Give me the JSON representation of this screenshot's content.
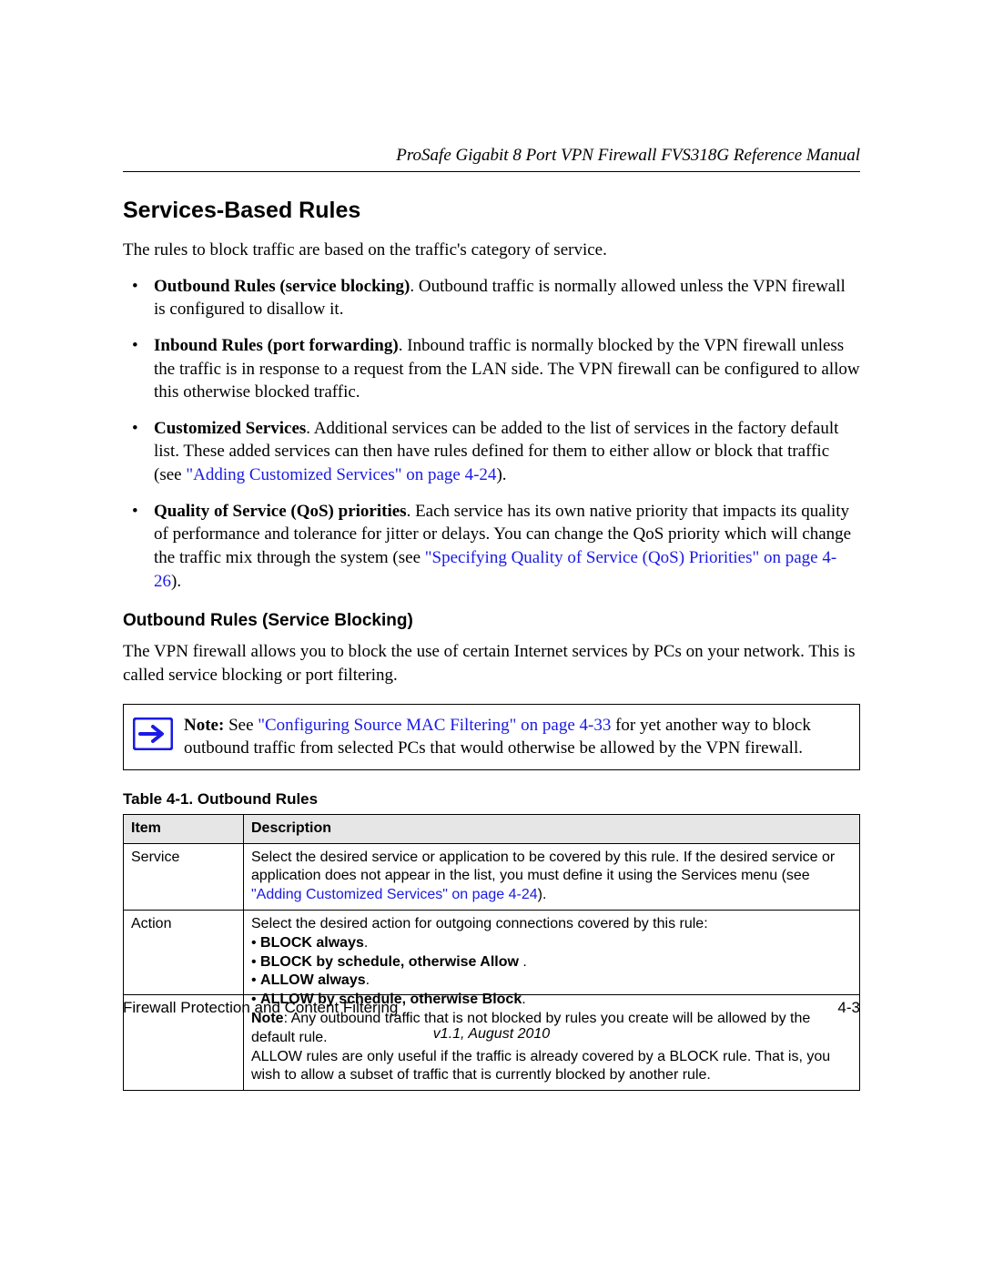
{
  "header": {
    "running": "ProSafe Gigabit 8 Port VPN Firewall FVS318G Reference Manual"
  },
  "section": {
    "title": "Services-Based Rules",
    "intro": "The rules to block traffic are based on the traffic's category of service."
  },
  "bullets": [
    {
      "bold_lead": "Outbound Rules (service blocking)",
      "text": ". Outbound traffic is normally allowed unless the VPN firewall is configured to disallow it."
    },
    {
      "bold_lead": "Inbound Rules (port forwarding)",
      "text": ". Inbound traffic is normally blocked by the VPN firewall unless the traffic is in response to a request from the LAN side. The VPN firewall can be configured to allow this otherwise blocked traffic."
    },
    {
      "bold_lead": "Customized Services",
      "text_before_link": ". Additional services can be added to the list of services in the factory default list. These added services can then have rules defined for them to either allow or block that traffic (see ",
      "link_text": "\"Adding Customized Services\" on page 4-24",
      "text_after_link": ")."
    },
    {
      "bold_lead": "Quality of Service (QoS) priorities",
      "text_before_link": ". Each service has its own native priority that impacts its quality of performance and tolerance for jitter or delays. You can change the QoS priority which will change the traffic mix through the system (see ",
      "link_text": "\"Specifying Quality of Service (QoS) Priorities\" on page 4-26",
      "text_after_link": ")."
    }
  ],
  "subsection": {
    "heading": "Outbound Rules (Service Blocking)",
    "para": "The VPN firewall allows you to block the use of certain Internet services by PCs on your network. This is called service blocking or port filtering."
  },
  "note": {
    "bold_lead": "Note:",
    "before_link": " See ",
    "link_text": "\"Configuring Source MAC Filtering\" on page 4-33",
    "after_link": " for yet another way to block outbound traffic from selected PCs that would otherwise be allowed by the VPN firewall."
  },
  "table": {
    "caption": "Table 4-1.  Outbound Rules",
    "headers": [
      "Item",
      "Description"
    ],
    "rows": {
      "service": {
        "item": "Service",
        "desc_before_link": "Select the desired service or application to be covered by this rule. If the desired service or application does not appear in the list, you must define it using the Services menu (see ",
        "link_text": "\"Adding Customized Services\" on page 4-24",
        "desc_after_link": ")."
      },
      "action": {
        "item": "Action",
        "lead": "Select the desired action for outgoing connections covered by this rule:",
        "options": [
          "BLOCK always",
          "BLOCK by schedule, otherwise Allow ",
          "ALLOW always",
          "ALLOW by schedule, otherwise Block"
        ],
        "note_bold": "Note",
        "note_rest": ": Any outbound traffic that is not blocked by rules you create will be allowed by the default rule.",
        "tail": "ALLOW rules are only useful if the traffic is already covered by a BLOCK rule. That is, you wish to allow a subset of traffic that is currently blocked by another rule."
      }
    }
  },
  "footer": {
    "left": "Firewall Protection and Content Filtering",
    "right": "4-3",
    "version": "v1.1, August 2010"
  }
}
